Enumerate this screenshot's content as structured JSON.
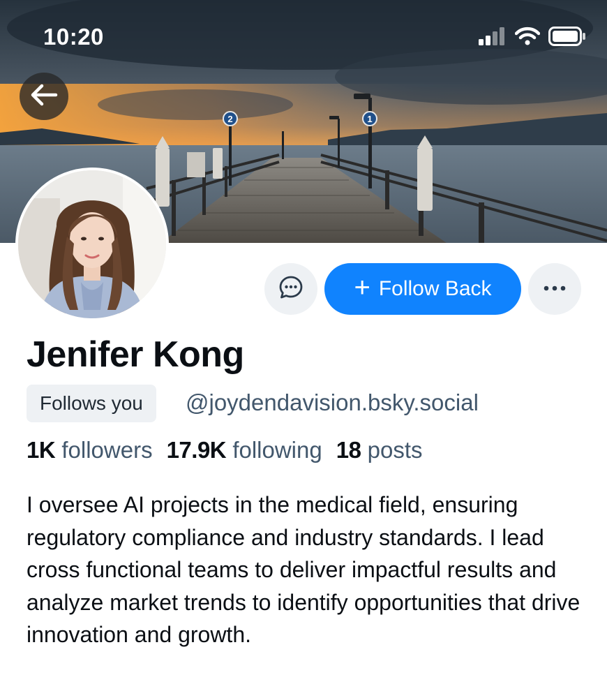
{
  "status_bar": {
    "time": "10:20"
  },
  "icons": {
    "back": "back-arrow-icon",
    "message": "chat-bubble-icon",
    "plus": "plus-icon",
    "more": "ellipsis-icon",
    "signal": "cellular-signal-icon",
    "wifi": "wifi-icon",
    "battery": "battery-icon"
  },
  "colors": {
    "accent": "#1083fe",
    "muted_text": "#42576c",
    "chip_bg": "#eef1f4"
  },
  "profile": {
    "display_name": "Jenifer Kong",
    "follows_you": "Follows you",
    "handle": "@joydendavision.bsky.social",
    "follow_button": "Follow Back",
    "follow_plus": "+",
    "stats": {
      "followers_count": "1K",
      "followers_label": "followers",
      "following_count": "17.9K",
      "following_label": "following",
      "posts_count": "18",
      "posts_label": "posts"
    },
    "bio": "I oversee AI projects in the medical field, ensuring regulatory compliance and industry standards. I lead cross functional teams to deliver impactful results and analyze market trends to identify opportunities that drive innovation and growth."
  }
}
